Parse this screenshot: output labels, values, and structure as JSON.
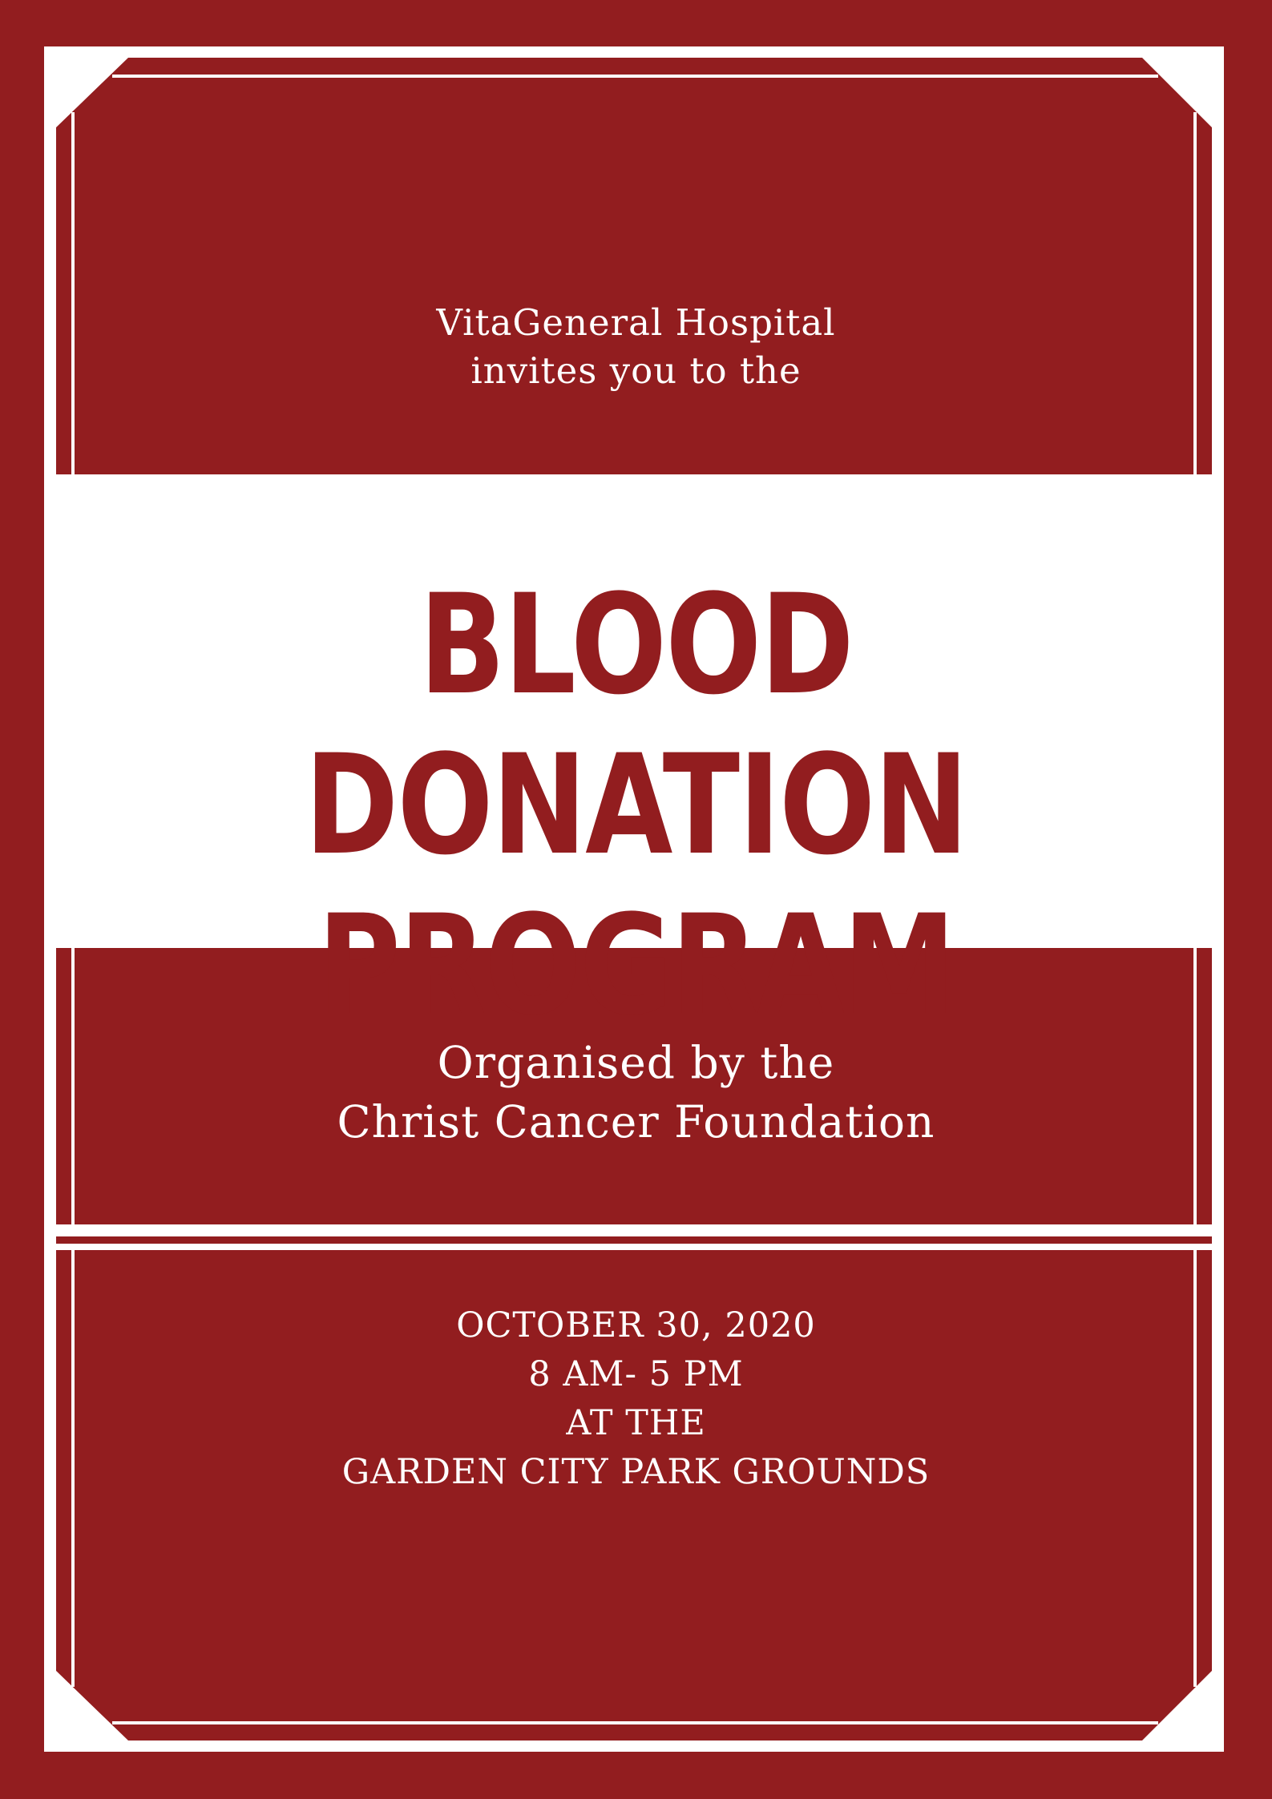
{
  "colors": {
    "primary_red": "#921d1f",
    "white": "#ffffff"
  },
  "header": {
    "line1": "VitaGeneral Hospital",
    "line2": "invites you to the"
  },
  "title": {
    "line1": "BLOOD DONATION",
    "line2": "PROGRAM"
  },
  "organiser": {
    "line1": "Organised by the",
    "line2": "Christ Cancer Foundation"
  },
  "details": {
    "date": "OCTOBER 30, 2020",
    "time": "8 AM- 5 PM",
    "at": "AT THE",
    "venue": "GARDEN CITY PARK GROUNDS"
  }
}
